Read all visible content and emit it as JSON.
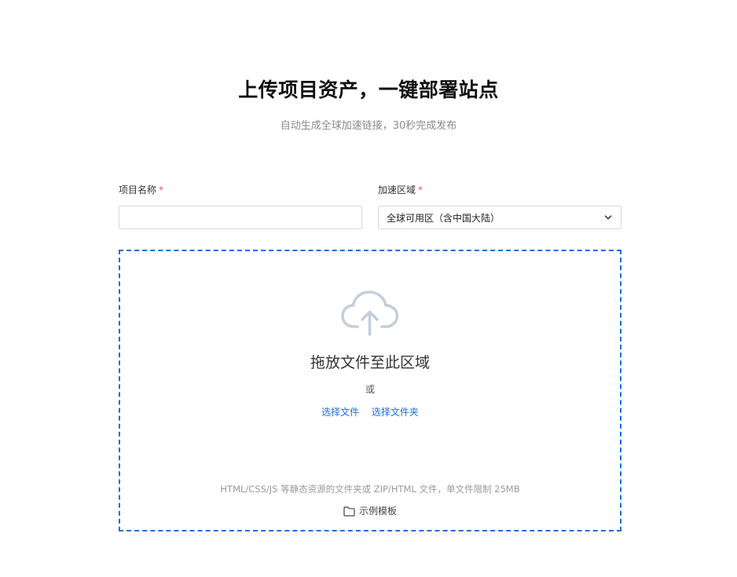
{
  "header": {
    "title": "上传项目资产，一键部署站点",
    "subtitle": "自动生成全球加速链接，30秒完成发布"
  },
  "form": {
    "name_label": "项目名称",
    "name_required_mark": "*",
    "name_value": "",
    "name_placeholder": "",
    "region_label": "加速区域",
    "region_required_mark": "*",
    "region_selected": "全球可用区（含中国大陆）"
  },
  "dropzone": {
    "drop_text": "拖放文件至此区域",
    "or_text": "或",
    "select_file": "选择文件",
    "select_folder": "选择文件夹",
    "hint": "HTML/CSS/JS 等静态资源的文件夹或 ZIP/HTML 文件，单文件限制 25MB",
    "template_label": "示例模板",
    "upload_icon": "cloud-upload-icon",
    "template_icon": "folder-icon"
  },
  "colors": {
    "accent": "#1d6fd8",
    "required": "#e34d59",
    "icon_gray": "#c5cddb",
    "border": "#d9d9d9"
  }
}
